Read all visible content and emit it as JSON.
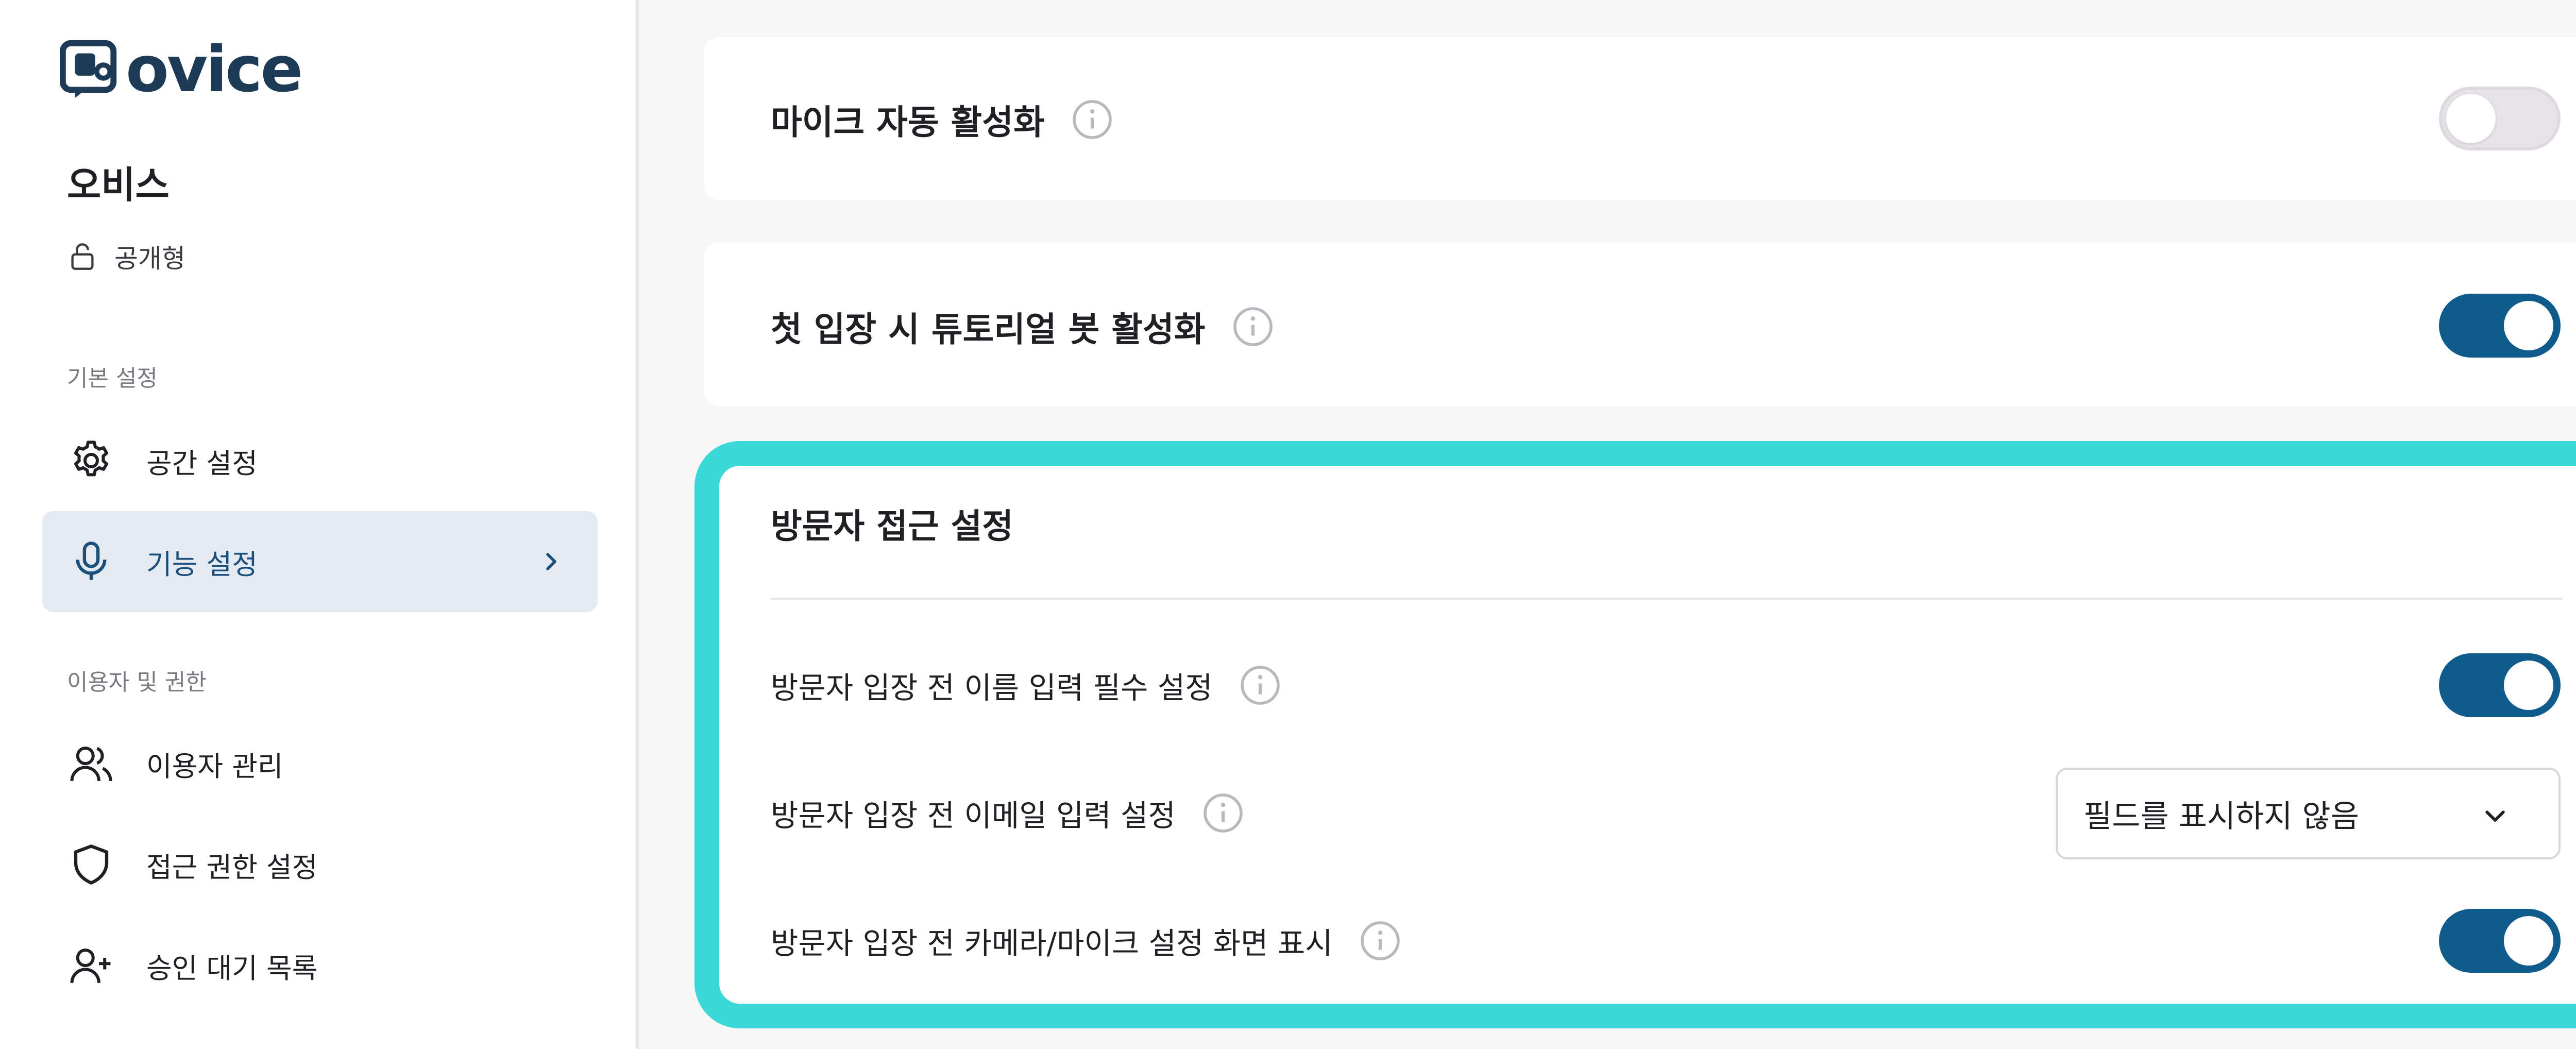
{
  "brand": {
    "name": "ovice"
  },
  "sidebar": {
    "space_name": "오비스",
    "space_type": "공개형",
    "sections": [
      {
        "label": "기본 설정",
        "items": [
          {
            "label": "공간 설정",
            "icon": "gear-icon"
          },
          {
            "label": "기능 설정",
            "icon": "microphone-icon",
            "active": true
          }
        ]
      },
      {
        "label": "이용자 및 권한",
        "items": [
          {
            "label": "이용자 관리",
            "icon": "users-icon"
          },
          {
            "label": "접근 권한 설정",
            "icon": "shield-icon"
          },
          {
            "label": "승인 대기 목록",
            "icon": "user-plus-icon"
          }
        ]
      }
    ]
  },
  "main": {
    "settings": [
      {
        "label": "마이크 자동 활성화",
        "enabled": false
      },
      {
        "label": "첫 입장 시 튜토리얼 봇 활성화",
        "enabled": true
      }
    ],
    "visitor_access": {
      "title": "방문자 접근 설정",
      "name_required": {
        "label": "방문자 입장 전 이름 입력 필수 설정",
        "enabled": true
      },
      "email_setting": {
        "label": "방문자 입장 전 이메일 입력 설정",
        "selected": "필드를 표시하지 않음"
      },
      "camera_mic_screen": {
        "label": "방문자 입장 전 카메라/마이크 설정 화면 표시",
        "enabled": true
      }
    }
  },
  "colors": {
    "accent": "#0f5b8c",
    "active_bg": "#e3eaf1",
    "highlight": "#3ad8d8",
    "logo": "#1d3b57"
  }
}
